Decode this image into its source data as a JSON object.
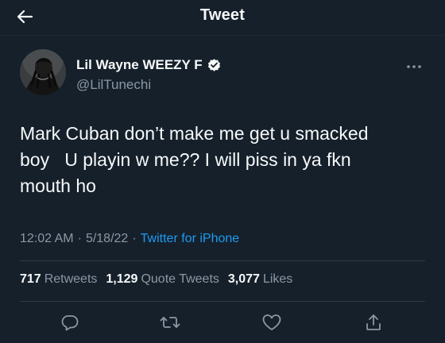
{
  "header": {
    "title": "Tweet",
    "back_icon": "arrow-left-icon"
  },
  "tweet": {
    "author": {
      "display_name": "Lil Wayne WEEZY F",
      "handle": "@LilTunechi",
      "verified": true
    },
    "text": "Mark Cuban don’t make me get u smacked\nboy   U playin w me?? I will piss in ya fkn\nmouth ho",
    "time": "12:02 AM",
    "date": "5/18/22",
    "separator": "·",
    "source": "Twitter for iPhone"
  },
  "stats": {
    "retweets": {
      "count": "717",
      "label": "Retweets"
    },
    "quotes": {
      "count": "1,129",
      "label": "Quote Tweets"
    },
    "likes": {
      "count": "3,077",
      "label": "Likes"
    }
  },
  "actions": [
    "reply-icon",
    "retweet-icon",
    "like-icon",
    "share-icon"
  ],
  "colors": {
    "background": "#15202b",
    "text_primary": "#f7f9f9",
    "text_secondary": "#8b98a5",
    "accent": "#1d9bf0",
    "divider": "#2f3b47"
  }
}
